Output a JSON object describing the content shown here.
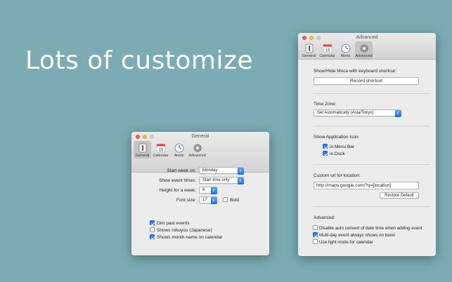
{
  "headline": "Lots of customize",
  "tabs": {
    "general": "General",
    "calendar": "Calendar",
    "alerts": "Alerts",
    "advanced": "Advanced",
    "calendar_icon_day": "15"
  },
  "general_window": {
    "title": "General",
    "start_week_label": "Start week on:",
    "start_week_value": "Monday",
    "show_event_times_label": "Show event times:",
    "show_event_times_value": "Start time only",
    "height_week_label": "Height for a week:",
    "height_week_value": "6",
    "font_size_label": "Font size:",
    "font_size_value": "17",
    "bold_label": "Bold",
    "dim_past_label": "Dim past events",
    "rokuyou_label": "Shows rokuyou (Japanese)",
    "month_name_label": "Shows month-name on calendar",
    "checks": {
      "bold": false,
      "dim_past": true,
      "rokuyou": false,
      "month_name": true
    }
  },
  "advanced_window": {
    "title": "Advanced",
    "shortcut_heading": "Show/Hide Moca with keyboard shortcut:",
    "record_shortcut": "Record shortcut",
    "timezone_heading": "Time Zone:",
    "timezone_value": "Set Automatically (Asia/Tokyo)",
    "app_icon_heading": "Show Application Icon:",
    "in_menu_bar": "in Menu Bar",
    "in_dock": "in Dock",
    "custom_url_heading": "Custom url for location:",
    "custom_url_value": "http://maps.google.com/?q=[location]",
    "restore_default": "Restore Default",
    "advanced_heading": "Advanced:",
    "disable_auto_convert": "Disable auto convert of date time when adding event",
    "multiday_band": "Multi-day event always shows on band",
    "light_mode": "Use light mode for calendar",
    "checks": {
      "menu_bar": true,
      "dock": true,
      "disable_auto_convert": false,
      "multiday": true,
      "light_mode": false
    }
  }
}
